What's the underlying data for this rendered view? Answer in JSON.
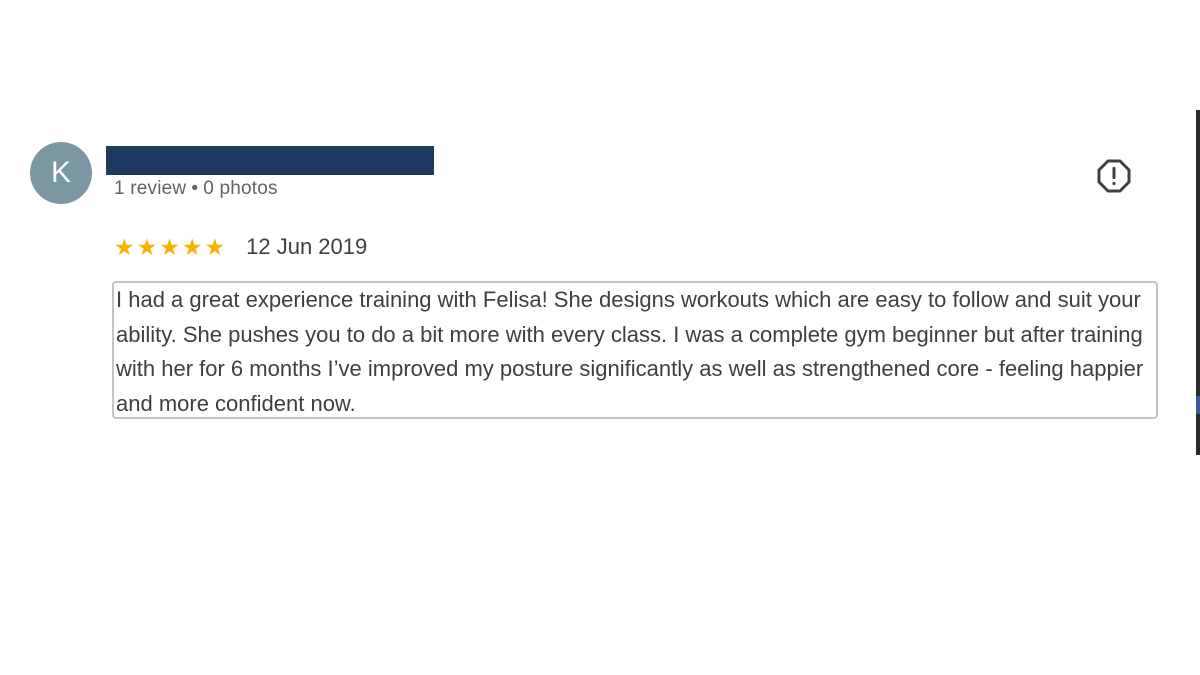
{
  "reviewer": {
    "avatar_initial": "K",
    "name": "",
    "review_count": "1 review",
    "separator": "•",
    "photo_count": "0 photos"
  },
  "review": {
    "rating": 5,
    "stars": [
      "★",
      "★",
      "★",
      "★",
      "★"
    ],
    "date": "12 Jun 2019",
    "text": "I had a great experience training with Felisa! She designs workouts which are easy to follow and suit your ability. She pushes you to do a bit more with every class. I was a complete gym beginner but after training with her for 6 months I’ve improved my posture significantly as well as strengthened core - feeling happier and more confident now."
  },
  "icons": {
    "report": "report-flag-icon",
    "star": "star-icon"
  },
  "colors": {
    "star": "#f4b400",
    "avatar_bg": "#7a97a3",
    "redaction": "#1f3a5f"
  }
}
